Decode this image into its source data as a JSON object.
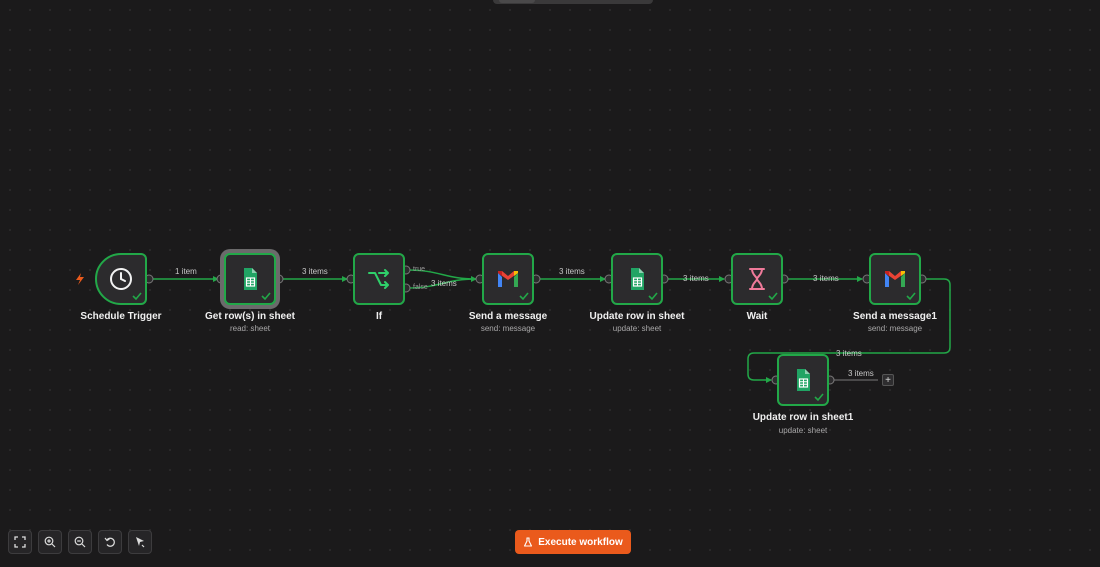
{
  "canvas": {
    "nodes": [
      {
        "id": "schedule",
        "title": "Schedule Trigger",
        "subtitle": "",
        "icon": "clock-icon"
      },
      {
        "id": "get-rows",
        "title": "Get row(s) in sheet",
        "subtitle": "read: sheet",
        "icon": "google-sheets-icon"
      },
      {
        "id": "if",
        "title": "If",
        "subtitle": "",
        "icon": "branch-icon"
      },
      {
        "id": "send-message",
        "title": "Send a message",
        "subtitle": "send: message",
        "icon": "gmail-icon"
      },
      {
        "id": "update-row",
        "title": "Update row in sheet",
        "subtitle": "update: sheet",
        "icon": "google-sheets-icon"
      },
      {
        "id": "wait",
        "title": "Wait",
        "subtitle": "",
        "icon": "hourglass-icon"
      },
      {
        "id": "send-message1",
        "title": "Send a message1",
        "subtitle": "send: message",
        "icon": "gmail-icon"
      },
      {
        "id": "update-row1",
        "title": "Update row in sheet1",
        "subtitle": "update: sheet",
        "icon": "google-sheets-icon"
      }
    ],
    "edges": {
      "e1": "1 item",
      "e2": "3 items",
      "e3": "3 items",
      "e4": "3 items",
      "e5": "3 items",
      "e6": "3 items",
      "e7": "3 items",
      "e8": "3 items"
    },
    "if_ports": {
      "true_label": "true",
      "false_label": "false"
    },
    "add_button": "+"
  },
  "toolbar": {
    "buttons": [
      "fit-view-icon",
      "zoom-in-icon",
      "zoom-out-icon",
      "reset-zoom-icon",
      "tidy-up-icon"
    ]
  },
  "execute_button": {
    "label": "Execute workflow",
    "icon": "flask-icon"
  },
  "colors": {
    "background": "#1b1a1b",
    "success": "#22a848",
    "accent": "#ea5a1c",
    "node_bg": "#2c2b2d"
  }
}
